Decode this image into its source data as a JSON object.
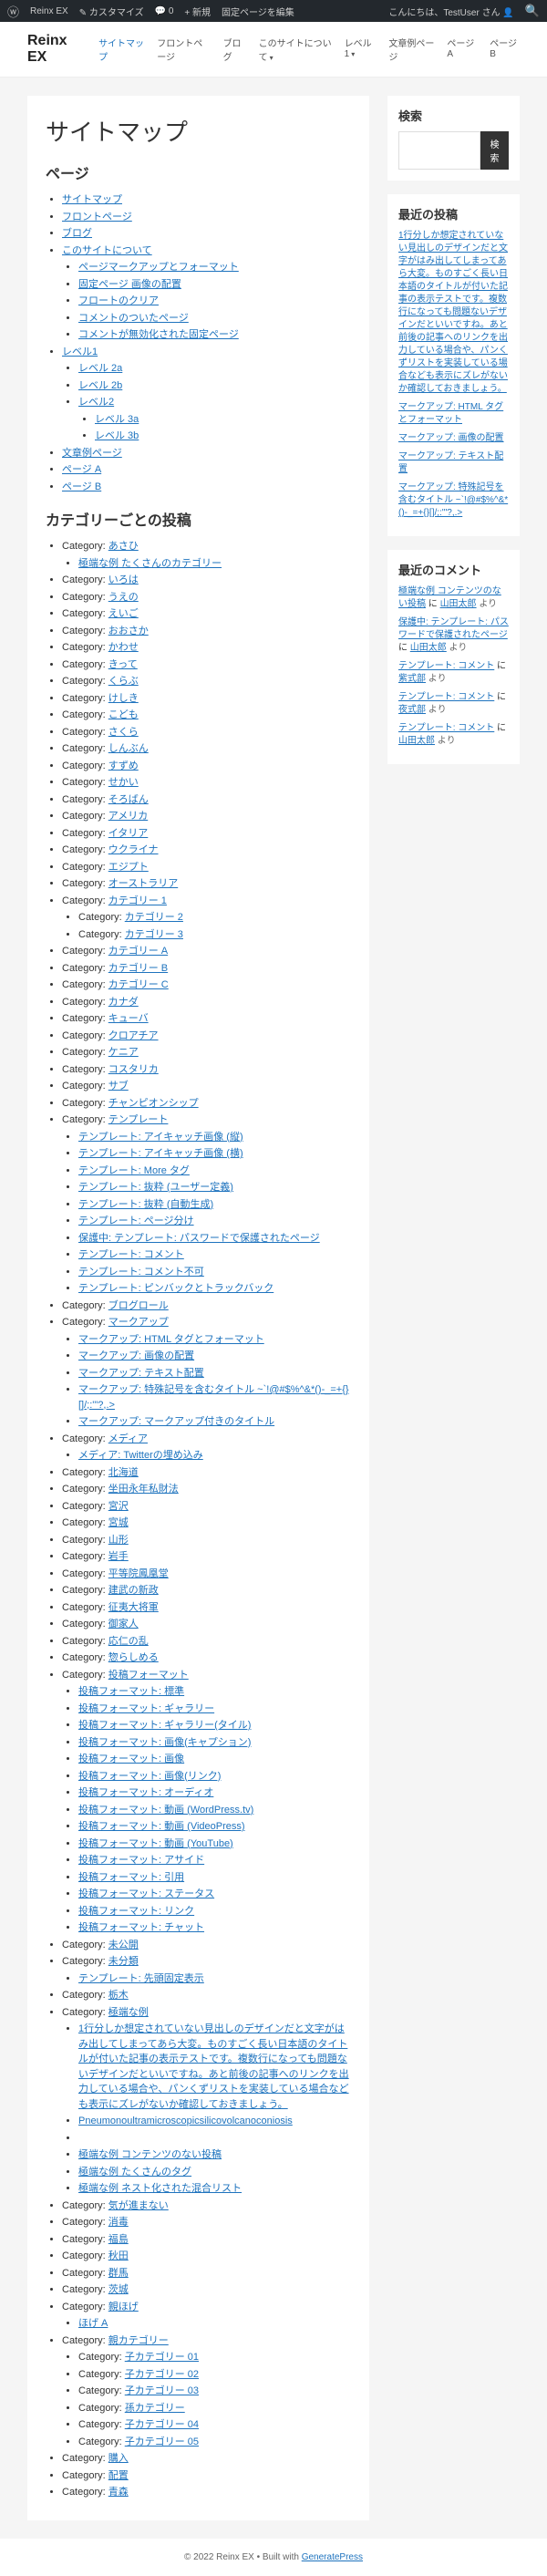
{
  "adminBar": {
    "siteName": "Reinx EX",
    "customize": "カスタマイズ",
    "comments": "0",
    "new": "新規",
    "editPage": "固定ページを編集",
    "greeting": "こんにちは、TestUser さん"
  },
  "header": {
    "siteTitle": "Reinx EX",
    "nav": [
      {
        "label": "サイトマップ",
        "active": true
      },
      {
        "label": "フロントページ"
      },
      {
        "label": "ブログ"
      },
      {
        "label": "このサイトについて",
        "dropdown": true
      },
      {
        "label": "レベル1",
        "dropdown": true
      },
      {
        "label": "文章例ページ"
      },
      {
        "label": "ページ A"
      },
      {
        "label": "ページ B"
      }
    ]
  },
  "page": {
    "title": "サイトマップ",
    "pagesHeading": "ページ",
    "categoriesHeading": "カテゴリーごとの投稿",
    "catLabel": "Category:"
  },
  "pages": [
    {
      "t": "サイトマップ"
    },
    {
      "t": "フロントページ"
    },
    {
      "t": "ブログ"
    },
    {
      "t": "このサイトについて",
      "children": [
        {
          "t": "ページマークアップとフォーマット"
        },
        {
          "t": "固定ページ  画像の配置"
        },
        {
          "t": "フロートのクリア"
        },
        {
          "t": "コメントのついたページ"
        },
        {
          "t": "コメントが無効化された固定ページ"
        }
      ]
    },
    {
      "t": "レベル1",
      "children": [
        {
          "t": "レベル 2a"
        },
        {
          "t": "レベル 2b"
        },
        {
          "t": "レベル2",
          "children": [
            {
              "t": "レベル 3a"
            },
            {
              "t": "レベル 3b"
            }
          ]
        }
      ]
    },
    {
      "t": "文章例ページ"
    },
    {
      "t": "ページ A"
    },
    {
      "t": "ページ B"
    }
  ],
  "categories": [
    {
      "name": "あさひ",
      "posts": [
        {
          "t": "極端な例  たくさんのカテゴリー"
        }
      ]
    },
    {
      "name": "いろは"
    },
    {
      "name": "うえの"
    },
    {
      "name": "えいご"
    },
    {
      "name": "おおさか"
    },
    {
      "name": "かわせ"
    },
    {
      "name": "きって"
    },
    {
      "name": "くらぶ"
    },
    {
      "name": "けしき"
    },
    {
      "name": "こども"
    },
    {
      "name": "さくら"
    },
    {
      "name": "しんぶん"
    },
    {
      "name": "すずめ"
    },
    {
      "name": "せかい"
    },
    {
      "name": "そろばん"
    },
    {
      "name": "アメリカ"
    },
    {
      "name": "イタリア"
    },
    {
      "name": "ウクライナ"
    },
    {
      "name": "エジプト"
    },
    {
      "name": "オーストラリア"
    },
    {
      "name": "カテゴリー 1",
      "subcats": [
        {
          "name": "カテゴリー 2"
        },
        {
          "name": "カテゴリー 3"
        }
      ]
    },
    {
      "name": "カテゴリー A"
    },
    {
      "name": "カテゴリー B"
    },
    {
      "name": "カテゴリー C"
    },
    {
      "name": "カナダ"
    },
    {
      "name": "キューバ"
    },
    {
      "name": "クロアチア"
    },
    {
      "name": "ケニア"
    },
    {
      "name": "コスタリカ"
    },
    {
      "name": "サブ"
    },
    {
      "name": "チャンピオンシップ"
    },
    {
      "name": "テンプレート",
      "posts": [
        {
          "t": "テンプレート: アイキャッチ画像 (縦)"
        },
        {
          "t": "テンプレート: アイキャッチ画像 (横)"
        },
        {
          "t": "テンプレート: More タグ"
        },
        {
          "t": "テンプレート: 抜粋 (ユーザー定義)"
        },
        {
          "t": "テンプレート: 抜粋 (自動生成)"
        },
        {
          "t": "テンプレート: ページ分け"
        },
        {
          "t": "保護中: テンプレート: パスワードで保護されたページ"
        },
        {
          "t": "テンプレート: コメント"
        },
        {
          "t": "テンプレート: コメント不可"
        },
        {
          "t": "テンプレート: ピンバックとトラックバック"
        }
      ]
    },
    {
      "name": "ブログロール"
    },
    {
      "name": "マークアップ",
      "posts": [
        {
          "t": "マークアップ: HTML タグとフォーマット"
        },
        {
          "t": "マークアップ: 画像の配置"
        },
        {
          "t": "マークアップ: テキスト配置"
        },
        {
          "t": "マークアップ: 特殊記号を含むタイトル ~`!@#$%^&*()-_=+{}[]/;:'\"?,.>"
        },
        {
          "t": "マークアップ: マークアップ付きのタイトル"
        }
      ]
    },
    {
      "name": "メディア",
      "posts": [
        {
          "t": "メディア: Twitterの埋め込み"
        }
      ]
    },
    {
      "name": "北海道"
    },
    {
      "name": "坐田永年私財法"
    },
    {
      "name": "宮沢"
    },
    {
      "name": "宮城"
    },
    {
      "name": "山形"
    },
    {
      "name": "岩手"
    },
    {
      "name": "平等院鳳凰堂"
    },
    {
      "name": "建武の新政"
    },
    {
      "name": "征夷大将軍"
    },
    {
      "name": "御家人"
    },
    {
      "name": "応仁の乱"
    },
    {
      "name": "惣らしめる"
    },
    {
      "name": "投稿フォーマット",
      "posts": [
        {
          "t": "投稿フォーマット: 標準"
        },
        {
          "t": "投稿フォーマット: ギャラリー"
        },
        {
          "t": "投稿フォーマット: ギャラリー(タイル)"
        },
        {
          "t": "投稿フォーマット: 画像(キャプション)"
        },
        {
          "t": "投稿フォーマット: 画像"
        },
        {
          "t": "投稿フォーマット: 画像(リンク)"
        },
        {
          "t": "投稿フォーマット: オーディオ"
        },
        {
          "t": "投稿フォーマット: 動画 (WordPress.tv)"
        },
        {
          "t": "投稿フォーマット: 動画 (VideoPress)"
        },
        {
          "t": "投稿フォーマット: 動画 (YouTube)"
        },
        {
          "t": "投稿フォーマット: アサイド"
        },
        {
          "t": "投稿フォーマット: 引用"
        },
        {
          "t": "投稿フォーマット: ステータス"
        },
        {
          "t": "投稿フォーマット: リンク"
        },
        {
          "t": "投稿フォーマット: チャット"
        }
      ]
    },
    {
      "name": "未公開"
    },
    {
      "name": "未分類",
      "posts": [
        {
          "t": "テンプレート: 先頭固定表示"
        }
      ]
    },
    {
      "name": "栃木"
    },
    {
      "name": "極端な例",
      "posts": [
        {
          "t": "1行分しか想定されていない見出しのデザインだと文字がはみ出してしまってあら大変。ものすごく長い日本語のタイトルが付いた記事の表示テストです。複数行になっても問題ないデザインだといいですね。あと前後の記事へのリンクを出力している場合や、パンくずリストを実装している場合なども表示にズレがないか確認しておきましょう。"
        },
        {
          "t": "Pneumonoultramicroscopicsilicovolcanoconiosis"
        },
        {
          "t": ""
        },
        {
          "t": "極端な例  コンテンツのない投稿"
        },
        {
          "t": "極端な例  たくさんのタグ"
        },
        {
          "t": "極端な例  ネスト化された混合リスト"
        }
      ]
    },
    {
      "name": "気が進まない"
    },
    {
      "name": "消毒"
    },
    {
      "name": "福島"
    },
    {
      "name": "秋田"
    },
    {
      "name": "群馬"
    },
    {
      "name": "茨城"
    },
    {
      "name": "親ほげ",
      "posts": [
        {
          "t": "ほげ A"
        }
      ]
    },
    {
      "name": "親カテゴリー",
      "subcats": [
        {
          "name": "子カテゴリー 01"
        },
        {
          "name": "子カテゴリー 02"
        },
        {
          "name": "子カテゴリー 03"
        },
        {
          "name": "孫カテゴリー"
        },
        {
          "name": "子カテゴリー 04"
        },
        {
          "name": "子カテゴリー 05"
        }
      ]
    },
    {
      "name": "購入"
    },
    {
      "name": "配置"
    },
    {
      "name": "青森"
    }
  ],
  "sidebar": {
    "search": {
      "title": "検索",
      "button": "検索"
    },
    "recentPosts": {
      "title": "最近の投稿",
      "items": [
        "1行分しか想定されていない見出しのデザインだと文字がはみ出してしまってあら大変。ものすごく長い日本語のタイトルが付いた記事の表示テストです。複数行になっても問題ないデザインだといいですね。あと前後の記事へのリンクを出力している場合や、パンくずリストを実装している場合なども表示にズレがないか確認しておきましょう。",
        "マークアップ: HTML タグとフォーマット",
        "マークアップ: 画像の配置",
        "マークアップ: テキスト配置",
        "マークアップ: 特殊記号を含むタイトル ~`!@#$%^&*()-_=+{}[]/;:'\"?,.>"
      ]
    },
    "recentComments": {
      "title": "最近のコメント",
      "items": [
        {
          "post": "極端な例  コンテンツのない投稿",
          "sep": "に",
          "author": "山田太郎",
          "suffix": "より"
        },
        {
          "post": "保護中: テンプレート: パスワードで保護されたページ",
          "sep": "に",
          "author": "山田太郎",
          "suffix": "より"
        },
        {
          "post": "テンプレート: コメント",
          "sep": "に",
          "author": "紫式部",
          "suffix": "より"
        },
        {
          "post": "テンプレート: コメント",
          "sep": "に",
          "author": "夜式部",
          "suffix": "より"
        },
        {
          "post": "テンプレート: コメント",
          "sep": "に",
          "author": "山田太郎",
          "suffix": "より"
        }
      ]
    }
  },
  "footer": {
    "copyright": "© 2022 Reinx EX",
    "sep": "• Built with",
    "theme": "GeneratePress"
  }
}
